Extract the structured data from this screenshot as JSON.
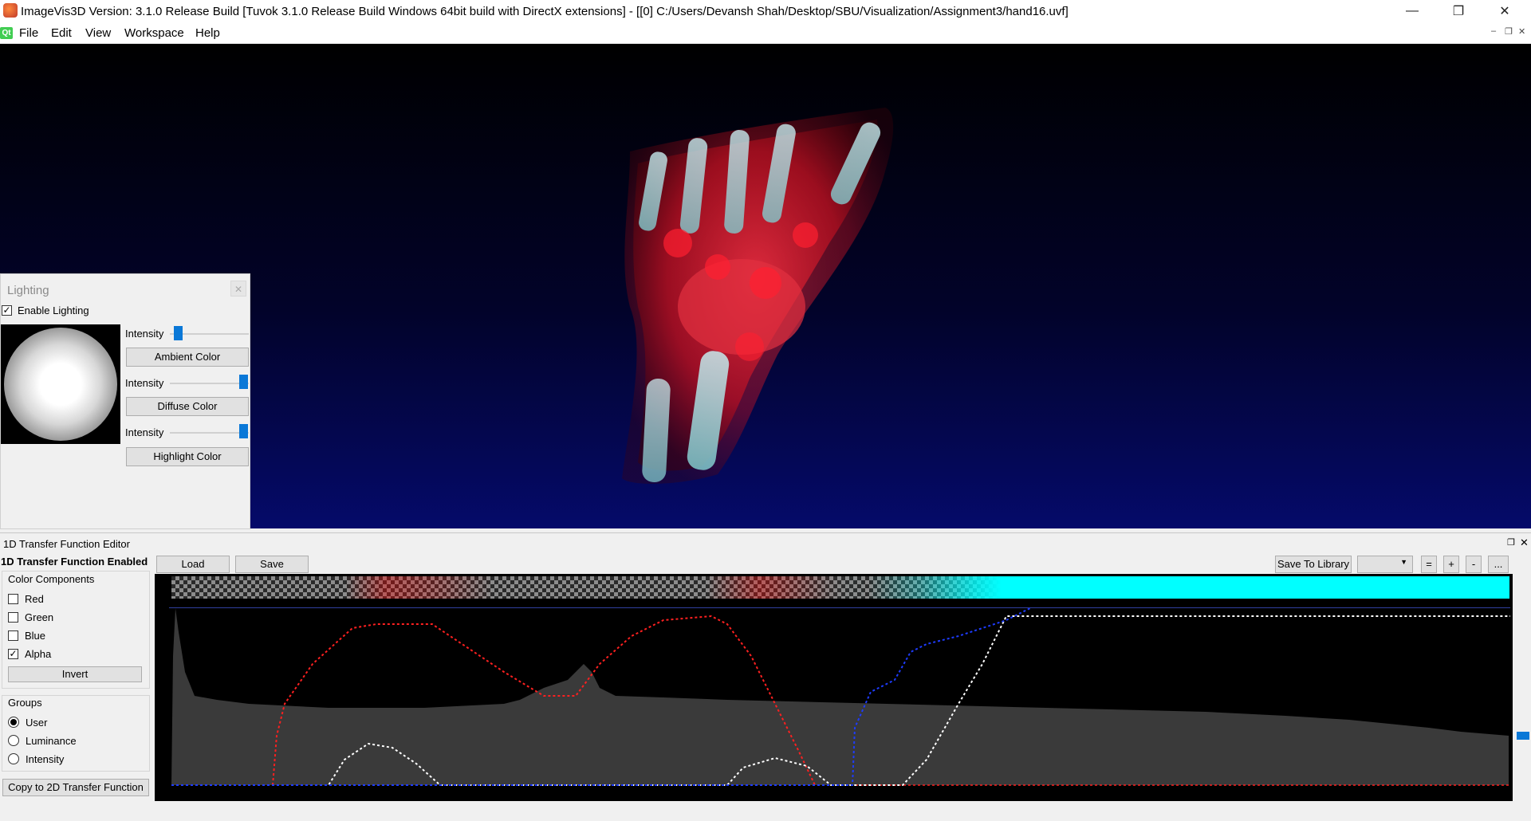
{
  "window": {
    "title": "ImageVis3D Version: 3.1.0 Release Build [Tuvok 3.1.0 Release Build Windows 64bit build with DirectX extensions] - [[0] C:/Users/Devansh Shah/Desktop/SBU/Visualization/Assignment3/hand16.uvf]",
    "minimize_icon": "minimize-icon",
    "restore_icon": "restore-icon",
    "close_icon": "close-icon"
  },
  "menu": {
    "logo": "Qt",
    "items": [
      "File",
      "Edit",
      "View",
      "Workspace",
      "Help"
    ]
  },
  "lighting": {
    "title": "Lighting",
    "enable_label": "Enable Lighting",
    "enabled": true,
    "ambient": {
      "intensity_label": "Intensity",
      "intensity": 0.05,
      "button": "Ambient Color"
    },
    "diffuse": {
      "intensity_label": "Intensity",
      "intensity": 1.0,
      "button": "Diffuse Color"
    },
    "specular": {
      "intensity_label": "Intensity",
      "intensity": 1.0,
      "button": "Highlight Color"
    }
  },
  "tf_editor": {
    "title": "1D Transfer Function Editor",
    "enabled_label": "1D Transfer Function Enabled",
    "load_label": "Load",
    "save_label": "Save",
    "save_library_label": "Save To Library",
    "library_select_value": "",
    "equals_label": "=",
    "plus_label": "+",
    "minus_label": "-",
    "more_label": "...",
    "color_components_title": "Color Components",
    "components": [
      {
        "label": "Red",
        "checked": false
      },
      {
        "label": "Green",
        "checked": false
      },
      {
        "label": "Blue",
        "checked": false
      },
      {
        "label": "Alpha",
        "checked": true
      }
    ],
    "invert_label": "Invert",
    "groups_title": "Groups",
    "groups": [
      {
        "label": "User",
        "selected": true
      },
      {
        "label": "Luminance",
        "selected": false
      },
      {
        "label": "Intensity",
        "selected": false
      }
    ],
    "copy_label": "Copy to 2D Transfer Function",
    "colors": {
      "red_curve": "#ff2020",
      "alpha_curve": "#ffffff",
      "blue_curve": "#1e3cff",
      "preview_end": "#00ffff",
      "histogram": "#3a3a3a"
    }
  }
}
